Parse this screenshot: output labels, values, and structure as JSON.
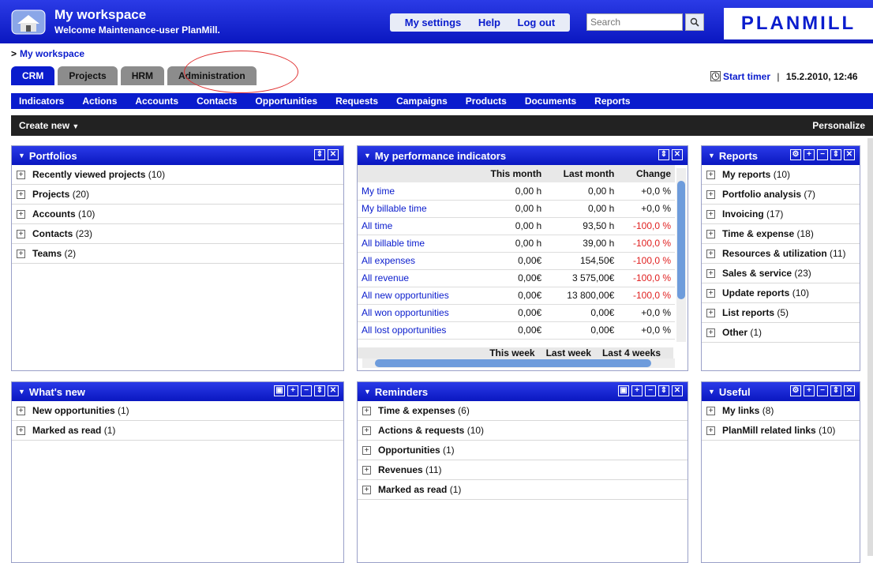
{
  "header": {
    "title": "My workspace",
    "welcome": "Welcome Maintenance-user PlanMill.",
    "links": [
      "My settings",
      "Help",
      "Log out"
    ],
    "search_placeholder": "Search",
    "logo": "PLANMILL"
  },
  "breadcrumb": {
    "arrow": ">",
    "label": "My workspace"
  },
  "tabs": [
    "CRM",
    "Projects",
    "HRM",
    "Administration"
  ],
  "timer": {
    "label": "Start timer",
    "separator": "|",
    "datetime": "15.2.2010, 12:46"
  },
  "nav": [
    "Indicators",
    "Actions",
    "Accounts",
    "Contacts",
    "Opportunities",
    "Requests",
    "Campaigns",
    "Products",
    "Documents",
    "Reports"
  ],
  "toolbar": {
    "create_new": "Create new",
    "personalize": "Personalize"
  },
  "portfolios": {
    "title": "Portfolios",
    "items": [
      {
        "label": "Recently viewed projects",
        "count": "(10)"
      },
      {
        "label": "Projects",
        "count": "(20)"
      },
      {
        "label": "Accounts",
        "count": "(10)"
      },
      {
        "label": "Contacts",
        "count": "(23)"
      },
      {
        "label": "Teams",
        "count": "(2)"
      }
    ]
  },
  "kpi": {
    "title": "My performance indicators",
    "columns": [
      "",
      "This month",
      "Last month",
      "Change"
    ],
    "rows": [
      {
        "label": "My time",
        "this": "0,00 h",
        "last": "0,00 h",
        "change": "+0,0 %",
        "neg": false
      },
      {
        "label": "My billable time",
        "this": "0,00 h",
        "last": "0,00 h",
        "change": "+0,0 %",
        "neg": false
      },
      {
        "label": "All time",
        "this": "0,00 h",
        "last": "93,50 h",
        "change": "-100,0 %",
        "neg": true
      },
      {
        "label": "All billable time",
        "this": "0,00 h",
        "last": "39,00 h",
        "change": "-100,0 %",
        "neg": true
      },
      {
        "label": "All expenses",
        "this": "0,00€",
        "last": "154,50€",
        "change": "-100,0 %",
        "neg": true
      },
      {
        "label": "All revenue",
        "this": "0,00€",
        "last": "3 575,00€",
        "change": "-100,0 %",
        "neg": true
      },
      {
        "label": "All new opportunities",
        "this": "0,00€",
        "last": "13 800,00€",
        "change": "-100,0 %",
        "neg": true
      },
      {
        "label": "All won opportunities",
        "this": "0,00€",
        "last": "0,00€",
        "change": "+0,0 %",
        "neg": false
      },
      {
        "label": "All lost opportunities",
        "this": "0,00€",
        "last": "0,00€",
        "change": "+0,0 %",
        "neg": false
      }
    ],
    "footer_columns": [
      "This week",
      "Last week",
      "Last 4 weeks"
    ]
  },
  "reports": {
    "title": "Reports",
    "items": [
      {
        "label": "My reports",
        "count": "(10)"
      },
      {
        "label": "Portfolio analysis",
        "count": "(7)"
      },
      {
        "label": "Invoicing",
        "count": "(17)"
      },
      {
        "label": "Time & expense",
        "count": "(18)"
      },
      {
        "label": "Resources & utilization",
        "count": "(11)"
      },
      {
        "label": "Sales & service",
        "count": "(23)"
      },
      {
        "label": "Update reports",
        "count": "(10)"
      },
      {
        "label": "List reports",
        "count": "(5)"
      },
      {
        "label": "Other",
        "count": "(1)"
      }
    ]
  },
  "whatsnew": {
    "title": "What's new",
    "items": [
      {
        "label": "New opportunities",
        "count": "(1)"
      },
      {
        "label": "Marked as read",
        "count": "(1)"
      }
    ]
  },
  "reminders": {
    "title": "Reminders",
    "items": [
      {
        "label": "Time & expenses",
        "count": "(6)"
      },
      {
        "label": "Actions & requests",
        "count": "(10)"
      },
      {
        "label": "Opportunities",
        "count": "(1)"
      },
      {
        "label": "Revenues",
        "count": "(11)"
      },
      {
        "label": "Marked as read",
        "count": "(1)"
      }
    ]
  },
  "useful": {
    "title": "Useful",
    "items": [
      {
        "label": "My links",
        "count": "(8)"
      },
      {
        "label": "PlanMill related links",
        "count": "(10)"
      }
    ]
  }
}
